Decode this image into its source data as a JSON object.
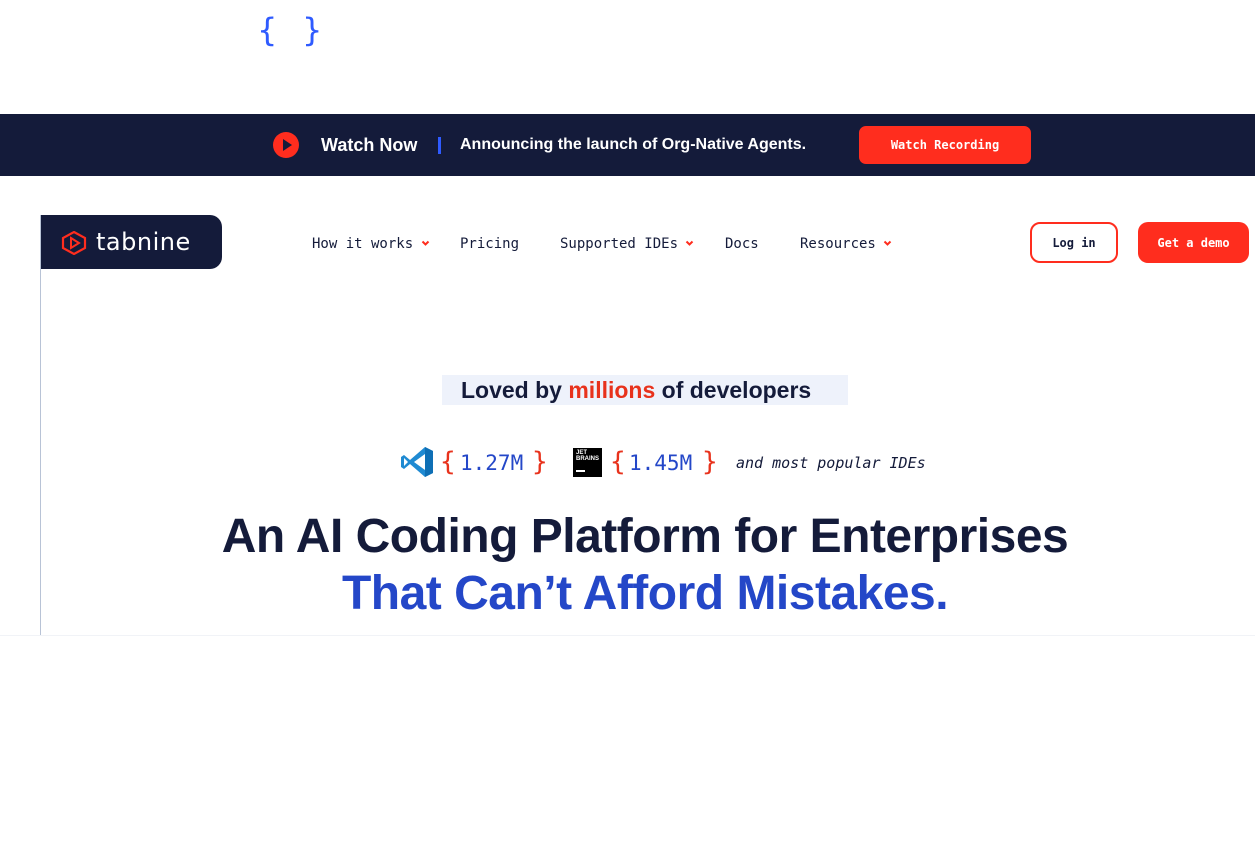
{
  "banner": {
    "watch_now": "Watch Now",
    "announcement": "Announcing the launch of Org-Native Agents.",
    "cta": "Watch Recording",
    "brace_open": "{",
    "brace_close": "}"
  },
  "header": {
    "logo_text": "tabnine",
    "nav": [
      {
        "label": "How it works",
        "has_dropdown": true
      },
      {
        "label": "Pricing",
        "has_dropdown": false
      },
      {
        "label": "Supported IDEs",
        "has_dropdown": true
      },
      {
        "label": "Docs",
        "has_dropdown": false
      },
      {
        "label": "Resources",
        "has_dropdown": true
      }
    ],
    "login": "Log in",
    "demo": "Get a demo"
  },
  "hero": {
    "loved_prefix": "Loved by ",
    "loved_highlight": "millions",
    "loved_suffix": " of developers",
    "vscode_count": "1.27M",
    "jetbrains_count": "1.45M",
    "jetbrains_logo_text": "JET BRAINS",
    "brace_open": "{",
    "brace_close": "}",
    "popular": "and most popular IDEs",
    "headline_line1": "An AI Coding Platform for Enterprises",
    "headline_line2": "That Can’t Afford Mistakes."
  },
  "colors": {
    "navy": "#141b3a",
    "accent_red": "#ff2d1e",
    "accent_blue": "#2447c8",
    "banner_blue": "#2f5bff"
  }
}
